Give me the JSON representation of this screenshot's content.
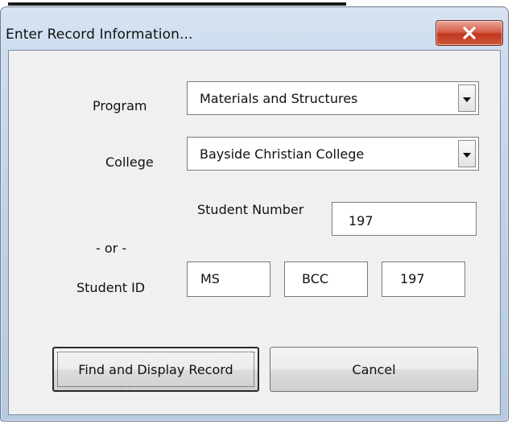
{
  "window": {
    "title": "Enter Record Information...",
    "close_label": "X",
    "close_icon": "close-icon"
  },
  "form": {
    "program": {
      "label": "Program",
      "value": "Materials and Structures",
      "dropdown_icon": "dropdown-arrow-icon"
    },
    "college": {
      "label": "College",
      "value": "Bayside Christian College",
      "dropdown_icon": "dropdown-arrow-icon"
    },
    "student_number": {
      "label": "Student Number",
      "value": "197"
    },
    "or_label": "- or -",
    "student_id": {
      "label": "Student ID",
      "part1": "MS",
      "part2": "BCC",
      "part3": "197"
    }
  },
  "buttons": {
    "find_label": "Find and Display Record",
    "cancel_label": "Cancel"
  },
  "colors": {
    "frame": "#c7d9ec",
    "client": "#f0f0f0",
    "close_button": "#c1371f"
  }
}
